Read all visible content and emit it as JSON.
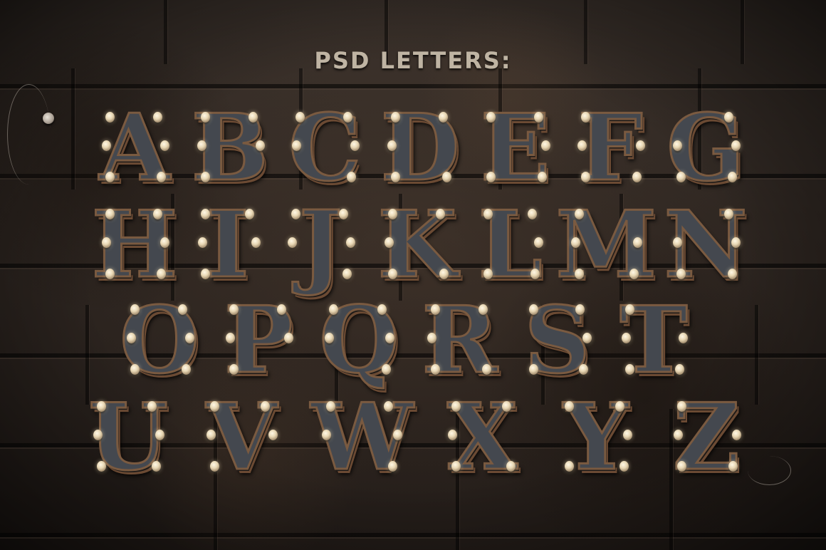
{
  "title": "PSD LETTERS:",
  "rows": [
    [
      "A",
      "B",
      "C",
      "D",
      "E",
      "F",
      "G"
    ],
    [
      "H",
      "I",
      "J",
      "K",
      "L",
      "M",
      "N"
    ],
    [
      "O",
      "P",
      "Q",
      "R",
      "S",
      "T"
    ],
    [
      "U",
      "V",
      "W",
      "X",
      "Y",
      "Z"
    ]
  ],
  "colors": {
    "background": "#2e2621",
    "title": "#bfb4a3",
    "letter_face": "#44484f",
    "letter_edge": "#7a5a40",
    "bulb_glow": "#fff8e6"
  },
  "icons": [
    "light-bulb-icon",
    "plug-icon"
  ]
}
